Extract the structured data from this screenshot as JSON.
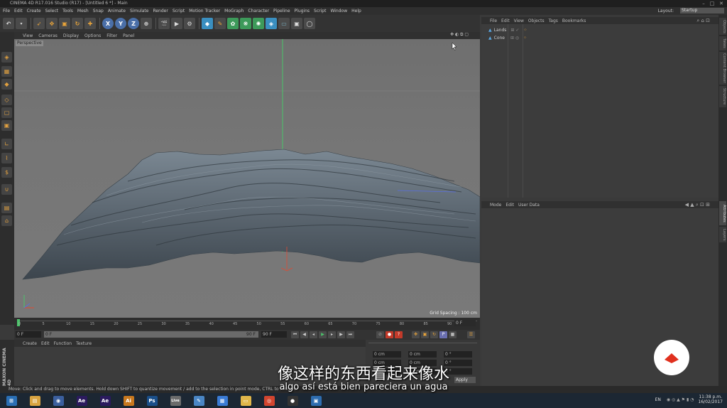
{
  "window": {
    "title": "CINEMA 4D R17.016 Studio (R17) - [Untitled 6 *] - Main",
    "controls": [
      "–",
      "□",
      "✕"
    ]
  },
  "menubar": {
    "items": [
      "File",
      "Edit",
      "Create",
      "Select",
      "Tools",
      "Mesh",
      "Snap",
      "Animate",
      "Simulate",
      "Render",
      "Script",
      "Motion Tracker",
      "MoGraph",
      "Character",
      "Pipeline",
      "Plugins",
      "Script",
      "Window",
      "Help"
    ],
    "layout_label": "Layout:",
    "layout_value": "Startup"
  },
  "toolbar": {
    "axis_x": "X",
    "axis_y": "Y",
    "axis_z": "Z"
  },
  "viewport": {
    "menu": [
      "View",
      "Cameras",
      "Display",
      "Options",
      "Filter",
      "Panel"
    ],
    "label": "Perspective",
    "grid_spacing": "Grid Spacing : 100 cm",
    "nav_icons": "✥ ◐ ⧉ ▢"
  },
  "timeline": {
    "ticks": [
      "0",
      "5",
      "10",
      "15",
      "20",
      "25",
      "30",
      "35",
      "40",
      "45",
      "50",
      "55",
      "60",
      "65",
      "70",
      "75",
      "80",
      "85",
      "90"
    ],
    "end_frame_label": "0 F",
    "current_frame": "0 F",
    "min_frame": "0 F",
    "max_frame": "90 F",
    "max_frame_2": "90 F"
  },
  "materials": {
    "menu": [
      "Create",
      "Edit",
      "Function",
      "Texture"
    ]
  },
  "coordinates": {
    "rows": [
      {
        "a": "0 cm",
        "b": "0 cm",
        "c": "0 °"
      },
      {
        "a": "0 cm",
        "b": "0 cm",
        "c": "0 °"
      },
      {
        "a": "0 cm",
        "b": "0 cm",
        "c": "0 °"
      }
    ],
    "apply": "Apply"
  },
  "objects_panel": {
    "menu": [
      "File",
      "Edit",
      "View",
      "Objects",
      "Tags",
      "Bookmarks"
    ],
    "items": [
      {
        "name": "Lands"
      },
      {
        "name": "Cone"
      }
    ]
  },
  "attributes_panel": {
    "menu": [
      "Mode",
      "Edit",
      "User Data"
    ]
  },
  "right_tabs": [
    "Objects",
    "Takes",
    "Content Browser",
    "Structure",
    "Attributes",
    "Layers"
  ],
  "statusbar": {
    "text": "Move: Click and drag to move elements. Hold down SHIFT to quantize movement / add to the selection in point mode, CTRL to remove."
  },
  "taskbar": {
    "apps": [
      {
        "name": "start",
        "glyph": "⊞",
        "color": "#2a6fb5"
      },
      {
        "name": "explorer",
        "glyph": "▤",
        "color": "#d9a441"
      },
      {
        "name": "cinema4d",
        "glyph": "◉",
        "color": "#3b5f9e"
      },
      {
        "name": "after-effects",
        "glyph": "Ae",
        "color": "#2b1a5e"
      },
      {
        "name": "after-effects-2",
        "glyph": "Ae",
        "color": "#2b1a5e"
      },
      {
        "name": "illustrator",
        "glyph": "Ai",
        "color": "#c8781e"
      },
      {
        "name": "photoshop",
        "glyph": "Ps",
        "color": "#1a4f8a"
      },
      {
        "name": "live",
        "glyph": "Live",
        "color": "#6b6b6b"
      },
      {
        "name": "paint",
        "glyph": "✎",
        "color": "#4a86c5"
      },
      {
        "name": "notes",
        "glyph": "▦",
        "color": "#3a7bd5"
      },
      {
        "name": "folder",
        "glyph": "▭",
        "color": "#e0b64a"
      },
      {
        "name": "chrome",
        "glyph": "◎",
        "color": "#d2452f"
      },
      {
        "name": "obs",
        "glyph": "●",
        "color": "#333"
      },
      {
        "name": "media",
        "glyph": "▣",
        "color": "#2e6db0"
      }
    ],
    "language": "EN",
    "time": "11:38 p.m.",
    "date": "16/02/2017"
  },
  "subtitles": {
    "chinese": "像这样的东西看起来像水",
    "spanish": "algo así está bien pareciera un agua"
  },
  "brand": {
    "maxon": "MAXON CINEMA 4D",
    "accent": "#e0301e"
  }
}
